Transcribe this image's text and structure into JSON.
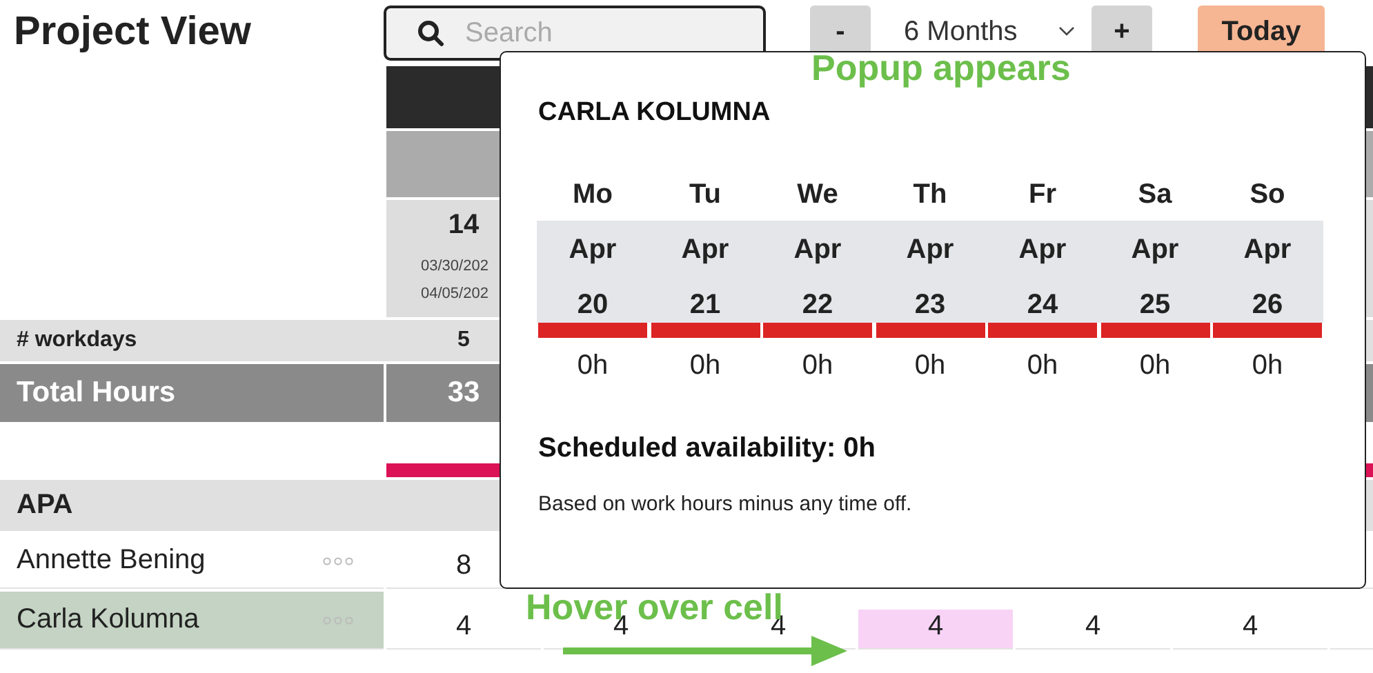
{
  "header": {
    "title": "Project View",
    "search": {
      "placeholder": "Search"
    },
    "zoom_out": "-",
    "range": "6 Months",
    "zoom_in": "+",
    "today": "Today"
  },
  "timeline": {
    "week": "14",
    "dates": [
      "03/30/202",
      "04/05/202"
    ],
    "alerts": {
      "first_column": true,
      "last_column": true
    }
  },
  "summary": [
    {
      "kind": "workdays",
      "label": "# workdays",
      "values": [
        "5"
      ]
    },
    {
      "kind": "total",
      "label": "Total Hours",
      "values": [
        "33"
      ]
    }
  ],
  "groups": [
    {
      "name": "APA",
      "people": [
        {
          "name": "Annette Bening",
          "selected": false,
          "cells": [
            {
              "value": "8",
              "hovered": false
            }
          ]
        },
        {
          "name": "Carla Kolumna",
          "selected": true,
          "cells": [
            {
              "value": "4",
              "hovered": false
            },
            {
              "value": "4",
              "hovered": false
            },
            {
              "value": "4",
              "hovered": false
            },
            {
              "value": "4",
              "hovered": true
            },
            {
              "value": "4",
              "hovered": false
            },
            {
              "value": "4",
              "hovered": false
            }
          ]
        }
      ]
    }
  ],
  "popup": {
    "title": "CARLA KOLUMNA",
    "days": [
      {
        "weekday": "Mo",
        "month": "Apr",
        "day": "20",
        "hours": "0h"
      },
      {
        "weekday": "Tu",
        "month": "Apr",
        "day": "21",
        "hours": "0h"
      },
      {
        "weekday": "We",
        "month": "Apr",
        "day": "22",
        "hours": "0h"
      },
      {
        "weekday": "Th",
        "month": "Apr",
        "day": "23",
        "hours": "0h"
      },
      {
        "weekday": "Fr",
        "month": "Apr",
        "day": "24",
        "hours": "0h"
      },
      {
        "weekday": "Sa",
        "month": "Apr",
        "day": "25",
        "hours": "0h"
      },
      {
        "weekday": "So",
        "month": "Apr",
        "day": "26",
        "hours": "0h"
      }
    ],
    "availability": "Scheduled availability: 0h",
    "note": "Based on work hours minus any time off."
  },
  "annotations": [
    {
      "kind": "popup",
      "text": "Popup appears"
    },
    {
      "kind": "hover",
      "text": "Hover over cell"
    }
  ]
}
